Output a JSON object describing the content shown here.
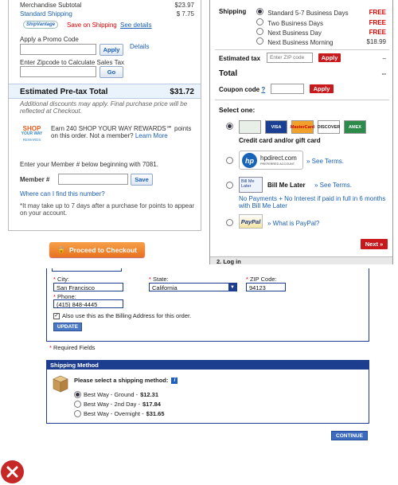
{
  "cart": {
    "subtotal_label": "Merchandise Subtotal",
    "subtotal_value": "$23.97",
    "shipping_label": "Standard Shipping",
    "shipping_value": "$ 7.75",
    "shipvantage_logo": "ShipVantage",
    "save_on_shipping": "Save on Shipping",
    "see_details": "See details",
    "promo_label": "Apply a Promo Code",
    "apply_label": "Apply",
    "details_label": "Details",
    "zip_label": "Enter Zipcode to Calculate Sales Tax",
    "go_label": "Go",
    "pretax_label": "Estimated Pre-tax Total",
    "pretax_value": "$31.72",
    "discount_note": "Additional discounts may apply. Final purchase price will be reflected at Checkout.",
    "shop_logo_line1": "SHOP",
    "shop_logo_line2": "YOUR WAY",
    "shop_logo_line3": "REWARDS",
    "rewards_text": "Earn 240 SHOP YOUR WAY REWARDS℠ points on this order. Not a member?",
    "learn_more": "Learn More",
    "member_prompt": "Enter your Member # below beginning with 7081.",
    "member_label": "Member #",
    "save_label": "Save",
    "find_number": "Where can I find this number?",
    "points_note": "*It may take up to 7 days after a purchase for points to appear on your account.",
    "checkout_label": "Proceed to Checkout"
  },
  "checkout": {
    "shipping_heading": "Shipping",
    "shipping_options": [
      {
        "label": "Standard 5-7 Business Days",
        "price": "FREE",
        "selected": true
      },
      {
        "label": "Two Business Days",
        "price": "FREE",
        "selected": false
      },
      {
        "label": "Next Business Day",
        "price": "FREE",
        "selected": false
      },
      {
        "label": "Next Business Morning",
        "price": "$18.99",
        "selected": false
      }
    ],
    "tax_label": "Estimated tax",
    "tax_placeholder": "Enter ZIP code",
    "apply_label": "Apply",
    "tax_value": "–",
    "total_label": "Total",
    "total_value": "--",
    "coupon_label": "Coupon code",
    "coupon_help": "?",
    "select_one": "Select one:",
    "cards": [
      "VISA",
      "MasterCard",
      "DISCOVER",
      "AMEX"
    ],
    "credit_card_label": "Credit card and/or gift card",
    "hp_logo": "hp",
    "hpdirect_text": "hpdirect.com",
    "hpdirect_sub": "PREFERRED ACCOUNT",
    "see_terms": "» See Terms.",
    "billmelater_logo": "Bill Me Later",
    "billmelater_label": "Bill Me Later",
    "billmelater_terms": "» See Terms.",
    "billmelater_promo": "No Payments + No Interest if paid in full in 6 months with Bill Me Later",
    "paypal_logo": "PayPal",
    "whatis_paypal": "» What is PayPal?",
    "next_label": "Next »",
    "login_label": "2. Log in"
  },
  "address": {
    "city_label": "City:",
    "city_value": "San Francisco",
    "state_label": "State:",
    "state_value": "California",
    "zip_label": "ZIP Code:",
    "zip_value": "94123",
    "phone_label": "Phone:",
    "phone_value": "(415) 848-4445",
    "billing_checkbox": "Also use this as the Billing Address for this order.",
    "update_label": "UPDATE",
    "required_note": "Required Fields",
    "shipping_method_heading": "Shipping Method",
    "select_method": "Please select a shipping method:",
    "info_icon": "i",
    "methods": [
      {
        "label": "Best Way - Ground - ",
        "price": "$12.31",
        "selected": true
      },
      {
        "label": "Best Way - 2nd Day - ",
        "price": "$17.84",
        "selected": false
      },
      {
        "label": "Best Way - Overnight - ",
        "price": "$31.65",
        "selected": false
      }
    ],
    "continue_label": "CONTINUE"
  },
  "colors": {
    "link_blue": "#1a5fb4",
    "price_red": "#d00000",
    "navy": "#1d3d8f",
    "orange": "#f07f2a",
    "reject_red": "#c62828"
  },
  "icons": [
    "x-mark-icon",
    "info-icon",
    "package-icon",
    "checkbox-icon",
    "dropdown-icon"
  ]
}
